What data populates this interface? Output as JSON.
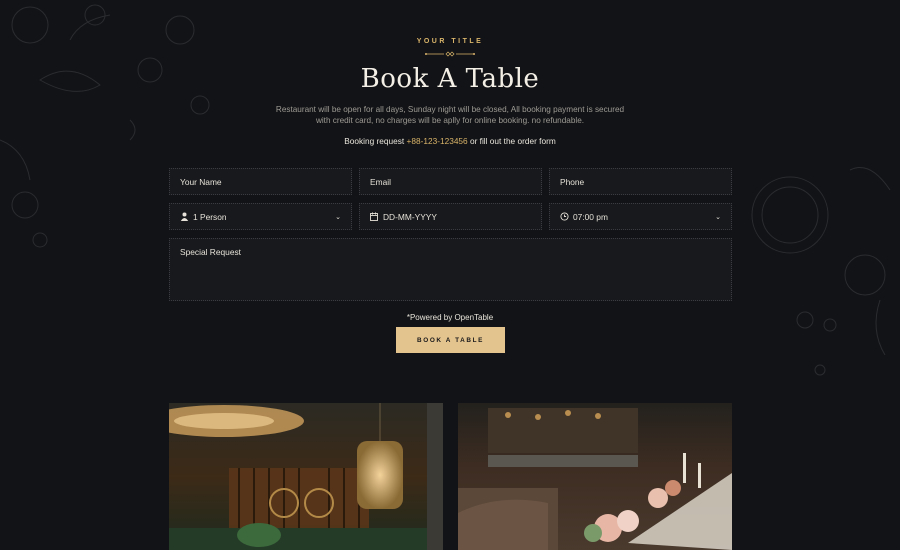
{
  "header": {
    "eyebrow": "YOUR TITLE",
    "title": "Book A Table",
    "description": "Restaurant will be open for all days, Sunday night will be closed, All booking payment is secured with credit card, no charges will be aplly for online booking. no refundable.",
    "booking_prefix": "Booking request ",
    "booking_phone": "+88-123-123456",
    "booking_suffix": " or fill out the order form"
  },
  "form": {
    "name_placeholder": "Your Name",
    "email_placeholder": "Email",
    "phone_placeholder": "Phone",
    "persons_value": "1 Person",
    "date_value": "DD-MM-YYYY",
    "time_value": "07:00 pm",
    "request_placeholder": "Special Request"
  },
  "powered_by": "*Powered by OpenTable",
  "book_button": "BOOK A TABLE",
  "colors": {
    "background": "#121316",
    "accent": "#d9b46a",
    "button": "#e4c48e"
  },
  "icons": [
    "user-icon",
    "calendar-icon",
    "clock-icon",
    "chevron-down-icon"
  ]
}
